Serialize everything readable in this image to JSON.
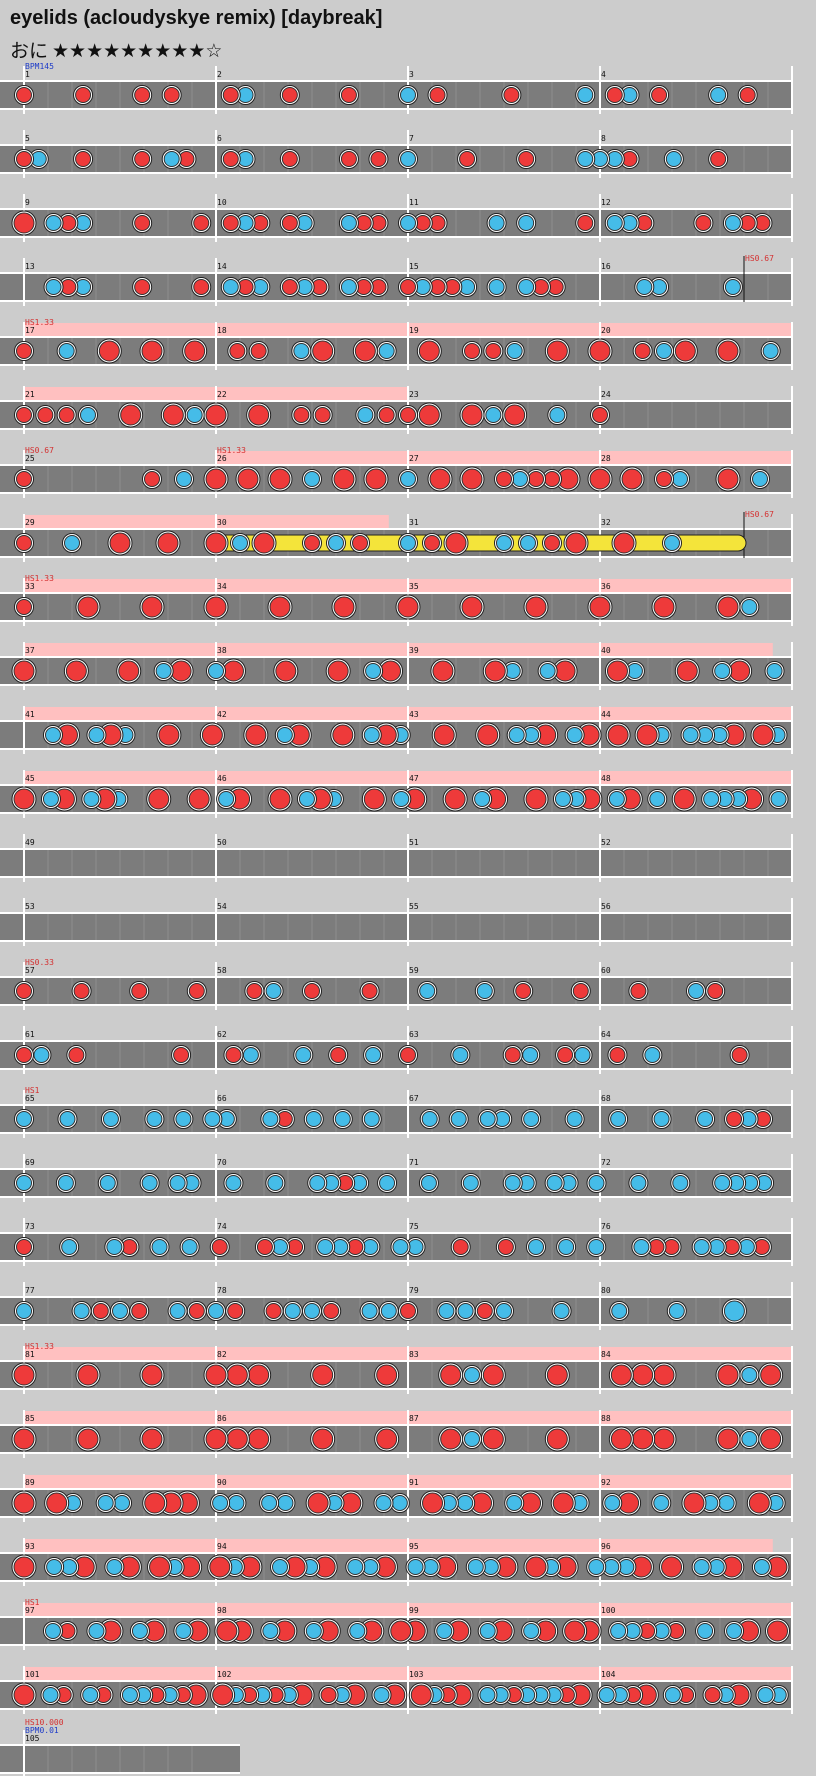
{
  "song": {
    "title": "eyelids (acloudyskye remix) [daybreak]",
    "difficulty": "おに",
    "stars": "★★★★★★★★★☆"
  },
  "rows": [
    {
      "measures": [
        "1",
        "2",
        "3",
        "4"
      ],
      "labels": [
        {
          "t": "BPM145",
          "c": "#1e3cc8"
        }
      ]
    },
    {
      "measures": [
        "5",
        "6",
        "7",
        "8"
      ],
      "labels": []
    },
    {
      "measures": [
        "9",
        "10",
        "11",
        "12"
      ],
      "labels": []
    },
    {
      "measures": [
        "13",
        "14",
        "15",
        "16"
      ],
      "labels": [],
      "marker": {
        "pos": 3.75,
        "t": "HS0.67"
      }
    },
    {
      "measures": [
        "17",
        "18",
        "19",
        "20"
      ],
      "labels": [
        {
          "t": "HS1.33",
          "c": "#d43030"
        }
      ],
      "pink": [
        0,
        4
      ]
    },
    {
      "measures": [
        "21",
        "22",
        "23",
        "24"
      ],
      "labels": [],
      "pink": [
        0,
        2
      ]
    },
    {
      "measures": [
        "25",
        "26",
        "27",
        "28"
      ],
      "labels": [
        {
          "t": "HS0.67",
          "c": "#d43030"
        },
        {
          "t": "HS1.33",
          "c": "#d43030",
          "at": 1
        }
      ],
      "pink": [
        1,
        4
      ]
    },
    {
      "measures": [
        "29",
        "30",
        "31",
        "32"
      ],
      "labels": [],
      "pink": [
        0,
        1.9
      ],
      "marker": {
        "pos": 3.75,
        "t": "HS0.67"
      },
      "drumroll": [
        1.0,
        3.75
      ]
    },
    {
      "measures": [
        "33",
        "34",
        "35",
        "36"
      ],
      "labels": [
        {
          "t": "HS1.33",
          "c": "#d43030"
        }
      ],
      "pink": [
        0,
        4
      ]
    },
    {
      "measures": [
        "37",
        "38",
        "39",
        "40"
      ],
      "labels": [],
      "pink": [
        0,
        3.9
      ]
    },
    {
      "measures": [
        "41",
        "42",
        "43",
        "44"
      ],
      "labels": [],
      "pink": [
        0,
        4
      ]
    },
    {
      "measures": [
        "45",
        "46",
        "47",
        "48"
      ],
      "labels": [],
      "pink": [
        0,
        4
      ]
    },
    {
      "measures": [
        "49",
        "50",
        "51",
        "52"
      ],
      "labels": []
    },
    {
      "measures": [
        "53",
        "54",
        "55",
        "56"
      ],
      "labels": []
    },
    {
      "measures": [
        "57",
        "58",
        "59",
        "60"
      ],
      "labels": [
        {
          "t": "HS0.33",
          "c": "#d43030"
        }
      ]
    },
    {
      "measures": [
        "61",
        "62",
        "63",
        "64"
      ],
      "labels": []
    },
    {
      "measures": [
        "65",
        "66",
        "67",
        "68"
      ],
      "labels": [
        {
          "t": "HS1",
          "c": "#d43030"
        }
      ]
    },
    {
      "measures": [
        "69",
        "70",
        "71",
        "72"
      ],
      "labels": []
    },
    {
      "measures": [
        "73",
        "74",
        "75",
        "76"
      ],
      "labels": []
    },
    {
      "measures": [
        "77",
        "78",
        "79",
        "80"
      ],
      "labels": []
    },
    {
      "measures": [
        "81",
        "82",
        "83",
        "84"
      ],
      "labels": [
        {
          "t": "HS1.33",
          "c": "#d43030"
        }
      ],
      "pink": [
        0,
        4
      ]
    },
    {
      "measures": [
        "85",
        "86",
        "87",
        "88"
      ],
      "labels": [],
      "pink": [
        0,
        4
      ]
    },
    {
      "measures": [
        "89",
        "90",
        "91",
        "92"
      ],
      "labels": [],
      "pink": [
        0,
        4
      ]
    },
    {
      "measures": [
        "93",
        "94",
        "95",
        "96"
      ],
      "labels": [],
      "pink": [
        0,
        3.9
      ]
    },
    {
      "measures": [
        "97",
        "98",
        "99",
        "100"
      ],
      "labels": [
        {
          "t": "HS1",
          "c": "#d43030"
        }
      ],
      "pink": [
        0,
        4
      ]
    },
    {
      "measures": [
        "101",
        "102",
        "103",
        "104"
      ],
      "labels": [],
      "pink": [
        0,
        4
      ]
    },
    {
      "measures": [
        "105"
      ],
      "labels": [
        {
          "t": "HS10.000",
          "c": "#d43030"
        },
        {
          "t": "BPM0.01",
          "c": "#1e3cc8"
        }
      ],
      "short": true
    }
  ],
  "notes": [
    "d...d...d.d...dk..d...d...k.d....d....k.dk.d...k.d..",
    "dk..d...d.kd..dk..d...d.d.k...d...d...kkkd..k..d....",
    "D.kdk...d...d.dkd.dk..kdd.kdd...k.k...d.kkd...d.kdd.",
    "..kdk...d...d.kdk.dkd.kdd.dkddk.k.kdd.....kk....k...",
    "d.k.D.D.D.dd.kD.Dk.D.ddk.D.D.dkD.D.k",
    "dddk.D.DkD.D.dd.kddD.DkD.k.d........",
    "d.......d.k.D.D.D.k.D.D.k.D.D.dkddD.D.D.dk..D.k.",
    "d.k.D.D.DkD.dkd.kdD.kkdD.D.k....",
    "d..D..D..D..D..D..D..D..D..D..D..Dk.",
    "D..D..D.kD.kD..D..D.kD..D..Dk.kD..Dk..D.kD.k",
    "..kD.kDk..D..D..D.kD..D.kDk..D..D.kkD.kD.D.Dk.kkkD.Dk",
    "D.kD.kDk..D..D.kD..D.kDk..D.kD..D.kD..D.kkD.kD.k.D.kkkD.k",
    "",
    "",
    "d..d..d..d..dk.d..d..k..k.d..d..d..kd...",
    "dk.d.....d..dk..k.d.k.d..k..dk.dk.d.k....d..",
    "k..k..k..k.k.kk..kd.k.k.k...k.k.kk.k..k..k..k..k.dkd.",
    "k..k..k..k.kk..k..k..kkdk.k..k..k..kk.kk.k..k..k..kkkk.",
    "d..k..kd.k.k.d..dkd.kkdk.kk..d..d.k.k.k..kdd.kkdkd.",
    "k..kdkd.kdkd.dkkd.kkd.kkdk..k..k..k..K..",
    "D..D..D..DDD..D..D..DkD..D..DDD..DkD",
    "D..D..D..DDD..D..D..DkD..D..DDD..DkD",
    "D.Dk.kk.DDD.kk.kk.DkD.kk.DkkD.kD.Dk.kD.k.Dkk.Dk",
    "D.kkD.kD.DkD.DkD.kDkD.kkD.kkD.kkD.DkD.kkkD.D.kkD.kD",
    "..kd.kD.kD.kD.DD.kD.kD.kD.DD.kD.kD.kD.DD.kkdkd.k.kD.D",
    "D.kd.kd.kkdkdD.DkdkdkD.dkD.kD.DkdD.kkdkkkdD.kkdD.kd.dkD.kk"
  ],
  "colors": {
    "don": "#ee3a3a",
    "ka": "#45bce8",
    "track": "#7c7c7c",
    "lane_border": "#ffffff",
    "pink_band": "#ffc0c0",
    "drumroll": "#f4e43a"
  }
}
